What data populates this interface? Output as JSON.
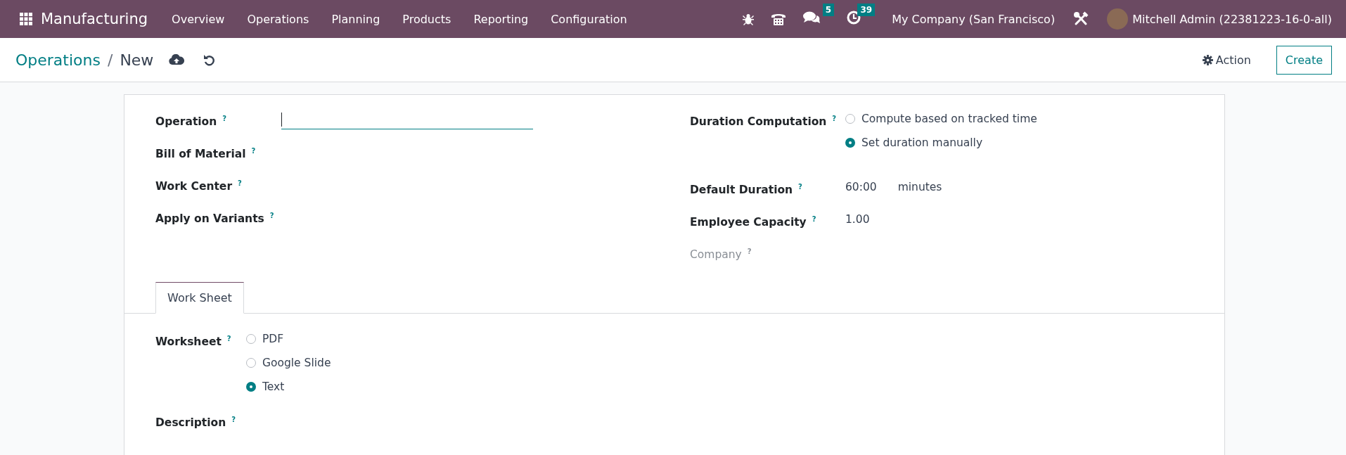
{
  "navbar": {
    "app_name": "Manufacturing",
    "menus": [
      {
        "label": "Overview"
      },
      {
        "label": "Operations"
      },
      {
        "label": "Planning"
      },
      {
        "label": "Products"
      },
      {
        "label": "Reporting"
      },
      {
        "label": "Configuration"
      }
    ],
    "chat_badge": "5",
    "activity_badge": "39",
    "company": "My Company (San Francisco)",
    "user": "Mitchell Admin (22381223-16-0-all)"
  },
  "control_panel": {
    "breadcrumb": [
      {
        "label": "Operations"
      },
      {
        "label": "New"
      }
    ],
    "separator": "/",
    "action": "Action",
    "create": "Create"
  },
  "form": {
    "left_fields": [
      {
        "label": "Operation",
        "help": "?",
        "kind": "input",
        "focused": true,
        "disabled": false
      },
      {
        "label": "Bill of Material",
        "help": "?",
        "kind": "empty",
        "disabled": false
      },
      {
        "label": "Work Center",
        "help": "?",
        "kind": "empty",
        "disabled": false
      },
      {
        "label": "Apply on Variants",
        "help": "?",
        "kind": "empty",
        "disabled": false
      }
    ],
    "right_fields": [
      {
        "label": "Duration Computation",
        "help": "?",
        "kind": "radio",
        "disabled": false,
        "options": [
          {
            "label": "Compute based on tracked time",
            "selected": false
          },
          {
            "label": "Set duration manually",
            "selected": true
          }
        ]
      },
      {
        "label": "Default Duration",
        "help": "?",
        "kind": "duration",
        "disabled": false,
        "value": "60:00",
        "unit": "minutes"
      },
      {
        "label": "Employee Capacity",
        "help": "?",
        "kind": "value",
        "disabled": false,
        "value": "1.00"
      },
      {
        "label": "Company",
        "help": "?",
        "kind": "empty",
        "disabled": true
      }
    ],
    "tabs": [
      {
        "label": "Work Sheet",
        "selected": true
      }
    ],
    "tab_fields": [
      {
        "label": "Worksheet",
        "help": "?",
        "kind": "radio",
        "disabled": false,
        "options": [
          {
            "label": "PDF",
            "selected": false
          },
          {
            "label": "Google Slide",
            "selected": false
          },
          {
            "label": "Text",
            "selected": true
          }
        ]
      },
      {
        "label": "Description",
        "help": "?",
        "kind": "empty",
        "disabled": false
      }
    ]
  }
}
